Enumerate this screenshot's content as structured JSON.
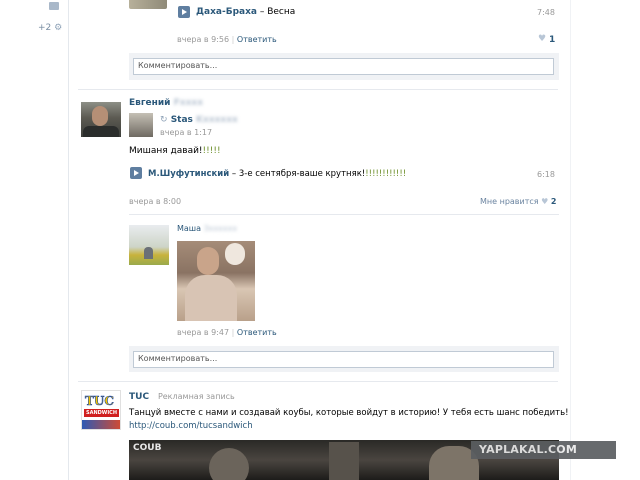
{
  "sidebar": {
    "counter": "+2"
  },
  "post1": {
    "track_artist": "Даха-Браха",
    "track_dash": " – ",
    "track_title": "Весна",
    "track_duration": "7:48",
    "timestamp": "вчера в 9:56",
    "reply_label": "Ответить",
    "likes": "1",
    "comment_placeholder": "Комментировать..."
  },
  "post2": {
    "author_first": "Евгений",
    "author_last_blurred": "Fxxxx",
    "repost_author_first": "Stas",
    "repost_author_last_blurred": "Kxxxxxx",
    "repost_time": "вчера в 1:17",
    "text_main": "Мишаня давай!",
    "text_excl": "!!!!!",
    "track_artist": "М.Шуфутинский",
    "track_dash": " – ",
    "track_title": "3-е сентября-ваше крутняк!",
    "track_excl": "!!!!!!!!!!!!",
    "track_duration": "6:18",
    "timestamp": "вчера в 8:00",
    "like_label": "Мне нравится",
    "likes": "2",
    "comment": {
      "author_first": "Маша",
      "author_last_blurred": "Зxxxxxx",
      "timestamp": "вчера в 9:47",
      "reply_label": "Ответить"
    },
    "comment_placeholder": "Комментировать..."
  },
  "post3": {
    "author": "TUC",
    "ad_label": "Рекламная запись",
    "logo_text": "TUC",
    "logo_subtext": "SANDWICH",
    "text": "Танцуй вместе с нами и создавай коубы, которые войдут в историю! У тебя есть шанс победить!",
    "link": "http://coub.com/tucsandwich",
    "video_label": "COUB"
  },
  "watermark": "YAPLAKAL.COM"
}
